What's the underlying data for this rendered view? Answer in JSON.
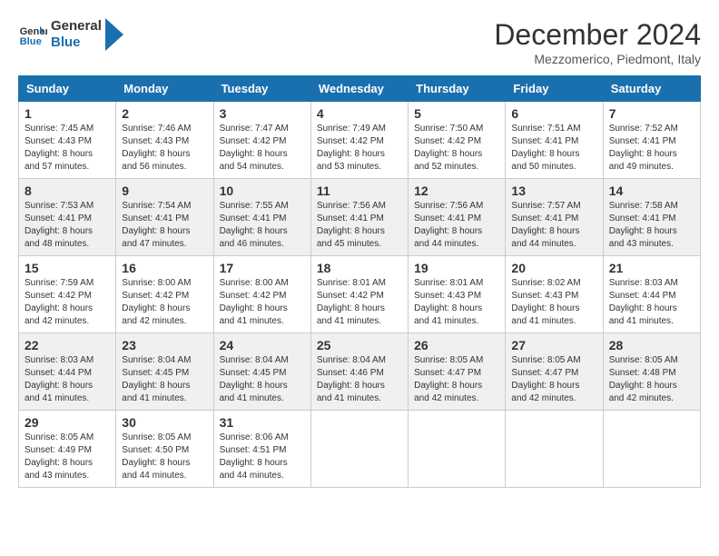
{
  "header": {
    "logo_line1": "General",
    "logo_line2": "Blue",
    "month_title": "December 2024",
    "subtitle": "Mezzomerico, Piedmont, Italy"
  },
  "days_of_week": [
    "Sunday",
    "Monday",
    "Tuesday",
    "Wednesday",
    "Thursday",
    "Friday",
    "Saturday"
  ],
  "weeks": [
    [
      {
        "day": "1",
        "sunrise": "7:45 AM",
        "sunset": "4:43 PM",
        "daylight": "8 hours and 57 minutes."
      },
      {
        "day": "2",
        "sunrise": "7:46 AM",
        "sunset": "4:43 PM",
        "daylight": "8 hours and 56 minutes."
      },
      {
        "day": "3",
        "sunrise": "7:47 AM",
        "sunset": "4:42 PM",
        "daylight": "8 hours and 54 minutes."
      },
      {
        "day": "4",
        "sunrise": "7:49 AM",
        "sunset": "4:42 PM",
        "daylight": "8 hours and 53 minutes."
      },
      {
        "day": "5",
        "sunrise": "7:50 AM",
        "sunset": "4:42 PM",
        "daylight": "8 hours and 52 minutes."
      },
      {
        "day": "6",
        "sunrise": "7:51 AM",
        "sunset": "4:41 PM",
        "daylight": "8 hours and 50 minutes."
      },
      {
        "day": "7",
        "sunrise": "7:52 AM",
        "sunset": "4:41 PM",
        "daylight": "8 hours and 49 minutes."
      }
    ],
    [
      {
        "day": "8",
        "sunrise": "7:53 AM",
        "sunset": "4:41 PM",
        "daylight": "8 hours and 48 minutes."
      },
      {
        "day": "9",
        "sunrise": "7:54 AM",
        "sunset": "4:41 PM",
        "daylight": "8 hours and 47 minutes."
      },
      {
        "day": "10",
        "sunrise": "7:55 AM",
        "sunset": "4:41 PM",
        "daylight": "8 hours and 46 minutes."
      },
      {
        "day": "11",
        "sunrise": "7:56 AM",
        "sunset": "4:41 PM",
        "daylight": "8 hours and 45 minutes."
      },
      {
        "day": "12",
        "sunrise": "7:56 AM",
        "sunset": "4:41 PM",
        "daylight": "8 hours and 44 minutes."
      },
      {
        "day": "13",
        "sunrise": "7:57 AM",
        "sunset": "4:41 PM",
        "daylight": "8 hours and 44 minutes."
      },
      {
        "day": "14",
        "sunrise": "7:58 AM",
        "sunset": "4:41 PM",
        "daylight": "8 hours and 43 minutes."
      }
    ],
    [
      {
        "day": "15",
        "sunrise": "7:59 AM",
        "sunset": "4:42 PM",
        "daylight": "8 hours and 42 minutes."
      },
      {
        "day": "16",
        "sunrise": "8:00 AM",
        "sunset": "4:42 PM",
        "daylight": "8 hours and 42 minutes."
      },
      {
        "day": "17",
        "sunrise": "8:00 AM",
        "sunset": "4:42 PM",
        "daylight": "8 hours and 41 minutes."
      },
      {
        "day": "18",
        "sunrise": "8:01 AM",
        "sunset": "4:42 PM",
        "daylight": "8 hours and 41 minutes."
      },
      {
        "day": "19",
        "sunrise": "8:01 AM",
        "sunset": "4:43 PM",
        "daylight": "8 hours and 41 minutes."
      },
      {
        "day": "20",
        "sunrise": "8:02 AM",
        "sunset": "4:43 PM",
        "daylight": "8 hours and 41 minutes."
      },
      {
        "day": "21",
        "sunrise": "8:03 AM",
        "sunset": "4:44 PM",
        "daylight": "8 hours and 41 minutes."
      }
    ],
    [
      {
        "day": "22",
        "sunrise": "8:03 AM",
        "sunset": "4:44 PM",
        "daylight": "8 hours and 41 minutes."
      },
      {
        "day": "23",
        "sunrise": "8:04 AM",
        "sunset": "4:45 PM",
        "daylight": "8 hours and 41 minutes."
      },
      {
        "day": "24",
        "sunrise": "8:04 AM",
        "sunset": "4:45 PM",
        "daylight": "8 hours and 41 minutes."
      },
      {
        "day": "25",
        "sunrise": "8:04 AM",
        "sunset": "4:46 PM",
        "daylight": "8 hours and 41 minutes."
      },
      {
        "day": "26",
        "sunrise": "8:05 AM",
        "sunset": "4:47 PM",
        "daylight": "8 hours and 42 minutes."
      },
      {
        "day": "27",
        "sunrise": "8:05 AM",
        "sunset": "4:47 PM",
        "daylight": "8 hours and 42 minutes."
      },
      {
        "day": "28",
        "sunrise": "8:05 AM",
        "sunset": "4:48 PM",
        "daylight": "8 hours and 42 minutes."
      }
    ],
    [
      {
        "day": "29",
        "sunrise": "8:05 AM",
        "sunset": "4:49 PM",
        "daylight": "8 hours and 43 minutes."
      },
      {
        "day": "30",
        "sunrise": "8:05 AM",
        "sunset": "4:50 PM",
        "daylight": "8 hours and 44 minutes."
      },
      {
        "day": "31",
        "sunrise": "8:06 AM",
        "sunset": "4:51 PM",
        "daylight": "8 hours and 44 minutes."
      },
      null,
      null,
      null,
      null
    ]
  ],
  "labels": {
    "sunrise": "Sunrise:",
    "sunset": "Sunset:",
    "daylight": "Daylight:"
  }
}
